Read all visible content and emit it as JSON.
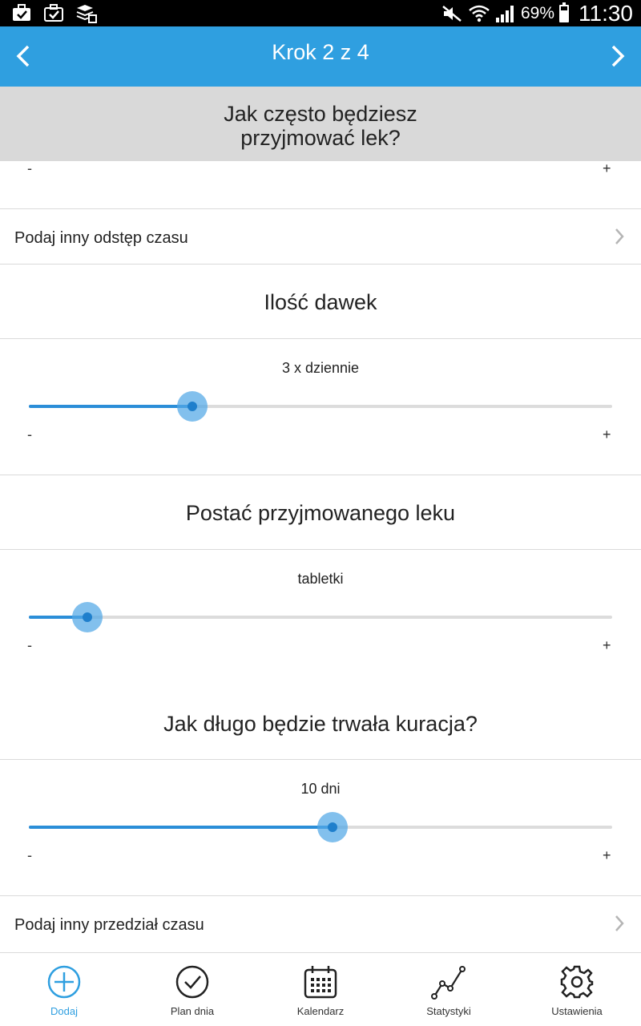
{
  "status_bar": {
    "battery_percent": "69%",
    "time": "11:30"
  },
  "header": {
    "title": "Krok 2 z 4",
    "prev_icon": "chevron-left-icon",
    "next_icon": "chevron-right-icon"
  },
  "question": {
    "line1": "Jak często będziesz",
    "line2": "przyjmować lek?"
  },
  "top_slider": {
    "minus": "-",
    "plus": "+"
  },
  "interval_link": {
    "label": "Podaj inny odstęp czasu"
  },
  "doses": {
    "title": "Ilość dawek",
    "value": "3 x dziennie",
    "fraction": 0.28,
    "minus": "-",
    "plus": "+"
  },
  "form": {
    "title": "Postać przyjmowanego leku",
    "value": "tabletki",
    "fraction": 0.1,
    "minus": "-",
    "plus": "+"
  },
  "duration": {
    "title": "Jak długo będzie trwała kuracja?",
    "value": "10 dni",
    "fraction": 0.52,
    "minus": "-",
    "plus": "+"
  },
  "period_link": {
    "label": "Podaj inny przedział czasu"
  },
  "bottom_nav": {
    "items": [
      {
        "label": "Dodaj",
        "icon": "add-circle-icon",
        "active": true
      },
      {
        "label": "Plan dnia",
        "icon": "check-circle-icon",
        "active": false
      },
      {
        "label": "Kalendarz",
        "icon": "calendar-icon",
        "active": false
      },
      {
        "label": "Statystyki",
        "icon": "stats-line-icon",
        "active": false
      },
      {
        "label": "Ustawienia",
        "icon": "gear-icon",
        "active": false
      }
    ]
  },
  "colors": {
    "accent": "#2f9fe0",
    "slider_fill": "#2b8ed8",
    "banner_gray": "#d9d9d9"
  }
}
